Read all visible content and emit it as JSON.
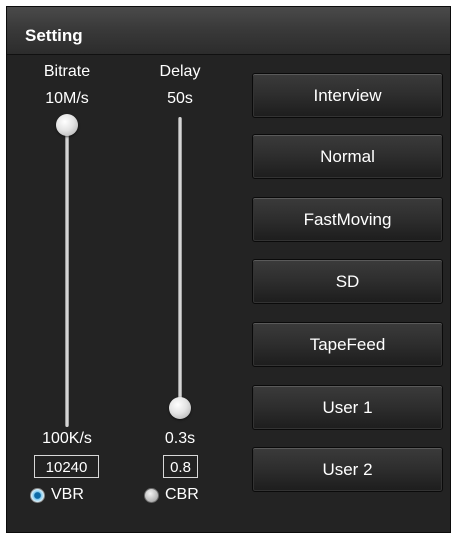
{
  "panel": {
    "title": "Setting"
  },
  "bitrate": {
    "label": "Bitrate",
    "max": "10M/s",
    "min": "100K/s",
    "value": "10240",
    "slider_position": 1.0
  },
  "delay": {
    "label": "Delay",
    "max": "50s",
    "min": "0.3s",
    "value": "0.8",
    "slider_position": 0.0
  },
  "modes": [
    {
      "label": "VBR",
      "selected": true
    },
    {
      "label": "CBR",
      "selected": false
    }
  ],
  "presets": [
    "Interview",
    "Normal",
    "FastMoving",
    "SD",
    "TapeFeed",
    "User 1",
    "User 2"
  ],
  "colors": {
    "panel_bg": "#232323",
    "radio_selected": "#3ba3dc",
    "text": "#ffffff"
  }
}
